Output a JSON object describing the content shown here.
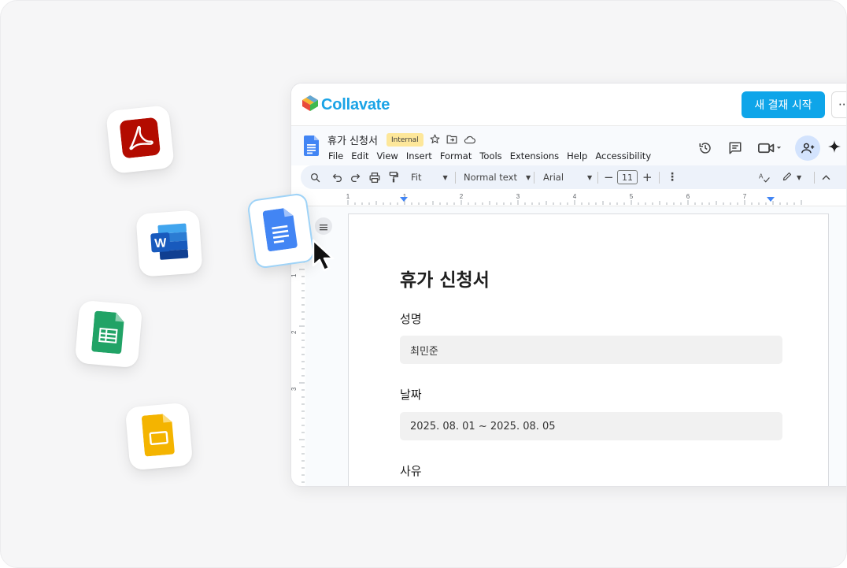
{
  "app": {
    "brand_name": "Collavate",
    "new_approval_button": "새 결재 시작",
    "more_button": "··"
  },
  "doc": {
    "title": "휴가 신청서",
    "badge": "Internal",
    "menu": [
      "File",
      "Edit",
      "View",
      "Insert",
      "Format",
      "Tools",
      "Extensions",
      "Help",
      "Accessibility"
    ]
  },
  "toolbar": {
    "zoom": "Fit",
    "style": "Normal text",
    "font": "Arial",
    "font_size": "11"
  },
  "ruler": {
    "numbers": [
      "1",
      "1",
      "2",
      "3",
      "4",
      "5",
      "6",
      "7"
    ],
    "left_numbers": [
      "1",
      "2",
      "3"
    ]
  },
  "page": {
    "heading": "휴가 신청서",
    "fields": [
      {
        "label": "성명",
        "value": "최민준"
      },
      {
        "label": "날짜",
        "value": "2025. 08. 01 ~ 2025. 08. 05"
      },
      {
        "label": "사유",
        "value": ""
      }
    ]
  },
  "icons": {
    "floating": [
      "pdf-icon",
      "word-icon",
      "sheets-icon",
      "slides-icon",
      "docs-icon"
    ],
    "header": [
      "history-icon",
      "comment-icon",
      "video-call-icon",
      "share-icon",
      "sparkle-icon"
    ]
  },
  "colors": {
    "brand": "#1aa3e6",
    "primary_button": "#0ea5e9",
    "badge": "#fde79a",
    "pdf": "#b30b00",
    "word": "#185abd",
    "sheets": "#21a366",
    "slides": "#f4b400",
    "docs": "#4285f4"
  }
}
